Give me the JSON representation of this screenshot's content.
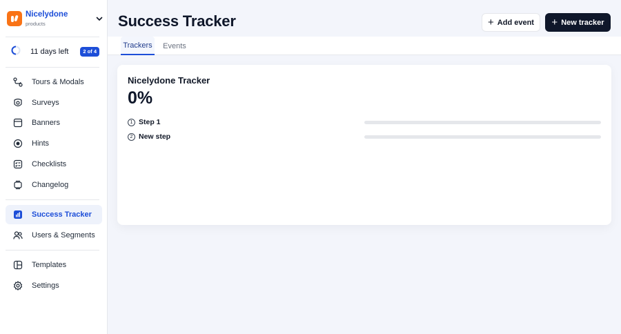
{
  "brand": {
    "name": "Nicelydone",
    "subtitle": "products"
  },
  "trial": {
    "text": "11 days left",
    "badge": "2 of 4"
  },
  "sidebar": {
    "items": [
      {
        "label": "Tours & Modals",
        "icon": "route-icon"
      },
      {
        "label": "Surveys",
        "icon": "survey-icon"
      },
      {
        "label": "Banners",
        "icon": "banner-icon"
      },
      {
        "label": "Hints",
        "icon": "hint-icon"
      },
      {
        "label": "Checklists",
        "icon": "checklist-icon"
      },
      {
        "label": "Changelog",
        "icon": "changelog-icon"
      },
      {
        "label": "Success Tracker",
        "icon": "bar-chart-icon",
        "active": true
      },
      {
        "label": "Users & Segments",
        "icon": "users-icon"
      },
      {
        "label": "Templates",
        "icon": "template-icon"
      },
      {
        "label": "Settings",
        "icon": "gear-icon"
      }
    ]
  },
  "header": {
    "title": "Success Tracker",
    "add_event_label": "Add event",
    "new_tracker_label": "New tracker"
  },
  "tabs": [
    {
      "label": "Trackers",
      "active": true
    },
    {
      "label": "Events",
      "active": false
    }
  ],
  "tracker": {
    "title": "Nicelydone Tracker",
    "percent": "0%",
    "steps": [
      {
        "num": "1",
        "label": "Step 1",
        "progress": 0
      },
      {
        "num": "2",
        "label": "New step",
        "progress": 0
      }
    ]
  },
  "colors": {
    "accent": "#1d4ed8",
    "brand_logo": "#f97316",
    "primary_button": "#0f172a",
    "background": "#f3f5fb"
  }
}
